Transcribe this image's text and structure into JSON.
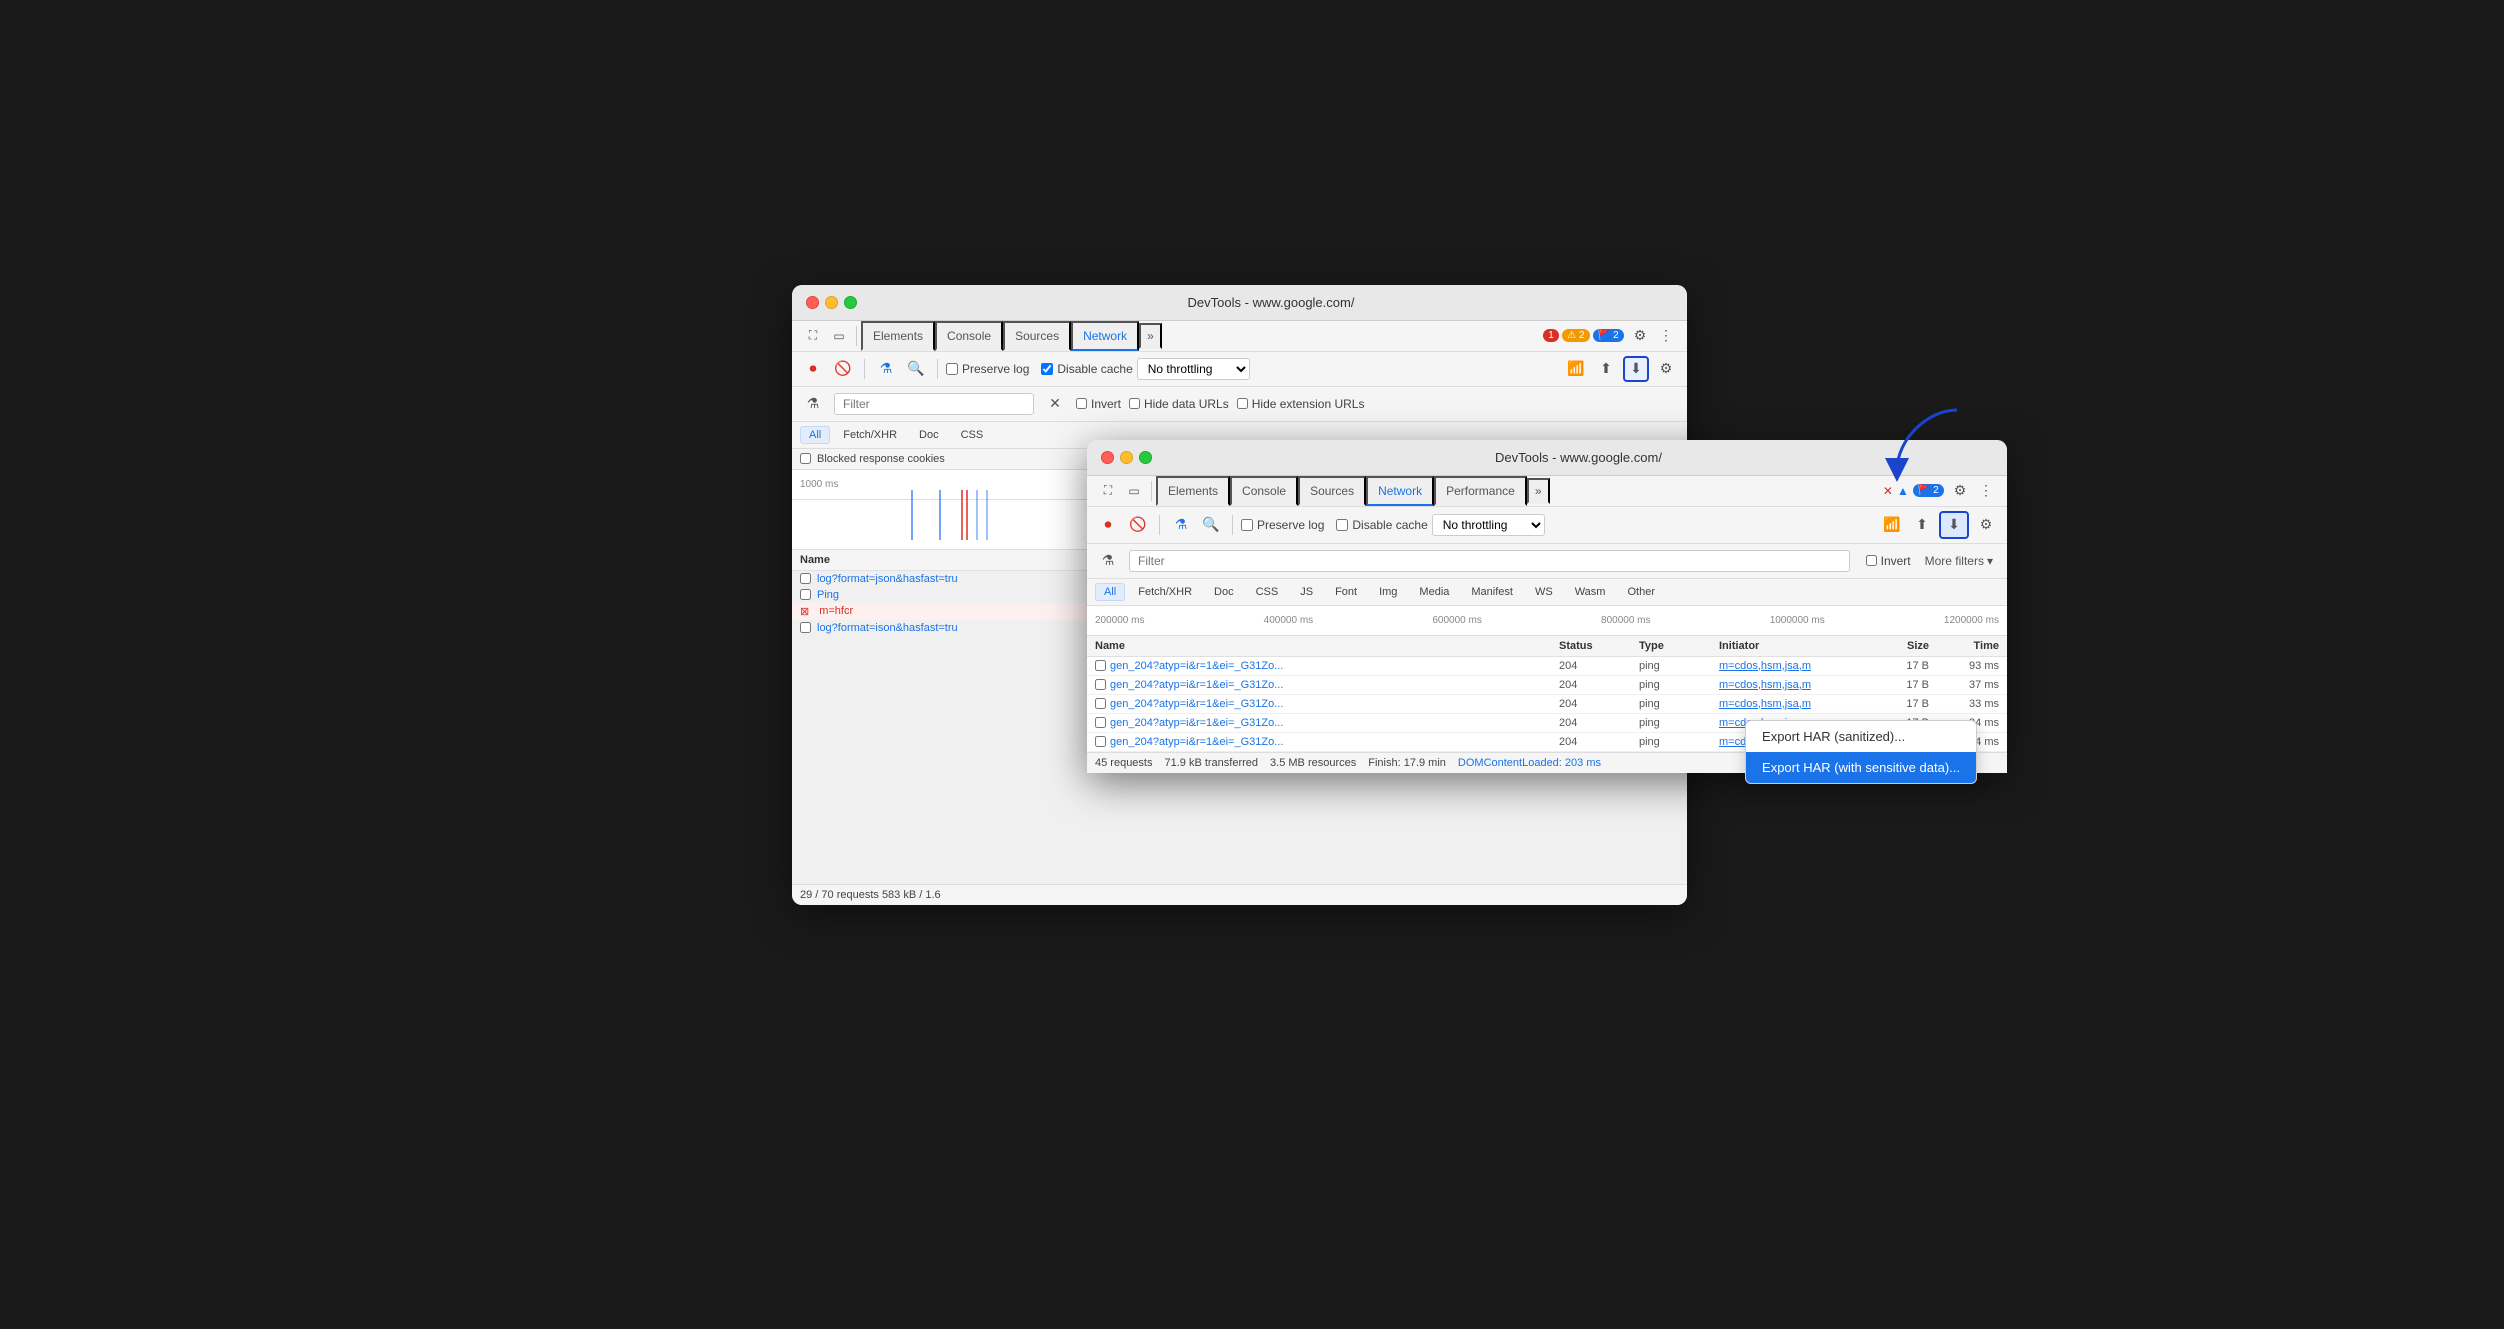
{
  "bg_window": {
    "title": "DevTools - www.google.com/",
    "tabs": [
      "Elements",
      "Console",
      "Sources",
      "Network"
    ],
    "active_tab": "Network",
    "toolbar": {
      "preserve_log": "Preserve log",
      "disable_cache": "Disable cache",
      "throttle": "No throttling",
      "errors": "1",
      "warnings": "2",
      "info": "2"
    },
    "filter_bar": {
      "invert": "Invert",
      "hide_data": "Hide data URLs",
      "hide_ext": "Hide extension URLs"
    },
    "type_filters": [
      "All",
      "Fetch/XHR",
      "Doc",
      "CSS"
    ],
    "blocked": "Blocked response cookies",
    "timeline_label": "1000 ms",
    "name_header": "Name",
    "rows": [
      {
        "name": "log?format=json&hasfast=tru",
        "checkbox": false,
        "error": false
      },
      {
        "name": "Ping",
        "checkbox": false,
        "error": false
      },
      {
        "name": "m=hfcr",
        "checkbox": false,
        "error": true
      },
      {
        "name": "log?format=ison&hasfast=tru",
        "checkbox": false,
        "error": false
      }
    ],
    "status_bar": "29 / 70 requests    583 kB / 1.6"
  },
  "fg_window": {
    "title": "DevTools - www.google.com/",
    "tabs": [
      "Elements",
      "Console",
      "Sources",
      "Network",
      "Performance"
    ],
    "active_tab": "Network",
    "toolbar": {
      "preserve_log": "Preserve log",
      "disable_cache": "Disable cache",
      "throttle": "No throttling"
    },
    "filter_placeholder": "Filter",
    "filter_bar": {
      "invert": "Invert",
      "more_filters": "More filters"
    },
    "type_filters": [
      "All",
      "Fetch/XHR",
      "Doc",
      "CSS",
      "JS",
      "Font",
      "Img",
      "Media",
      "Manifest",
      "WS",
      "Wasm",
      "Other"
    ],
    "active_type": "All",
    "timeline_labels": [
      "200000 ms",
      "400000 ms",
      "600000 ms",
      "800000 ms",
      "1000000 ms",
      "1200000 ms"
    ],
    "table_headers": [
      "Name",
      "Status",
      "Type",
      "Initiator",
      "Size",
      "Time"
    ],
    "table_rows": [
      {
        "name": "gen_204?atyp=i&r=1&ei=_G31Zo...",
        "status": "204",
        "type": "ping",
        "initiator": "m=cdos,hsm,jsa,m",
        "size": "17 B",
        "time": "93 ms"
      },
      {
        "name": "gen_204?atyp=i&r=1&ei=_G31Zo...",
        "status": "204",
        "type": "ping",
        "initiator": "m=cdos,hsm,jsa,m",
        "size": "17 B",
        "time": "37 ms"
      },
      {
        "name": "gen_204?atyp=i&r=1&ei=_G31Zo...",
        "status": "204",
        "type": "ping",
        "initiator": "m=cdos,hsm,jsa,m",
        "size": "17 B",
        "time": "33 ms"
      },
      {
        "name": "gen_204?atyp=i&r=1&ei=_G31Zo...",
        "status": "204",
        "type": "ping",
        "initiator": "m=cdos,hsm,jsa,m",
        "size": "17 B",
        "time": "94 ms"
      },
      {
        "name": "gen_204?atyp=i&r=1&ei=_G31Zo...",
        "status": "204",
        "type": "ping",
        "initiator": "m=cdos,hsm,jsa,m",
        "size": "17 B",
        "time": "44 ms"
      }
    ],
    "status_bar": {
      "requests": "45 requests",
      "transferred": "71.9 kB transferred",
      "resources": "3.5 MB resources",
      "finish": "Finish: 17.9 min",
      "dom_loaded": "DOMContentLoaded: 203 ms"
    }
  },
  "dropdown": {
    "items": [
      {
        "label": "Export HAR (sanitized)...",
        "selected": false
      },
      {
        "label": "Export HAR (with sensitive data)...",
        "selected": true
      }
    ]
  },
  "icons": {
    "stop": "⏹",
    "clear": "🚫",
    "filter": "⚗",
    "search": "🔍",
    "settings": "⚙",
    "more": "⋮",
    "download": "⬇",
    "upload": "⬆",
    "wifi": "📶",
    "select_all": "⊞",
    "cursor": "↖",
    "device": "📱",
    "close": "✕",
    "more_tools": "»",
    "kebab": "⋮"
  }
}
